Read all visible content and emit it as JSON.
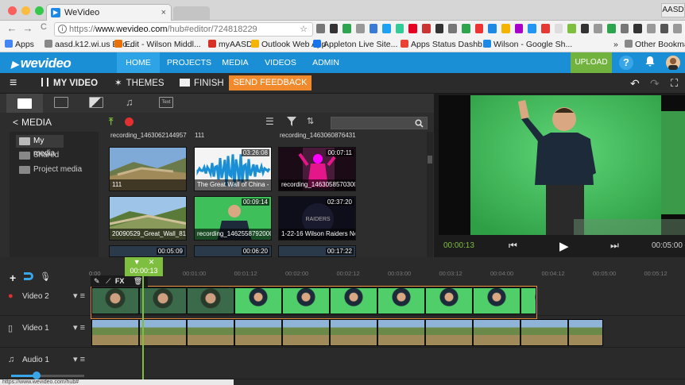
{
  "browser": {
    "tab_title": "WeVideo",
    "tab_close": "×",
    "profile": "AASD",
    "url_prefix": "https://",
    "url_host": "www.wevideo.com",
    "url_path": "/hub#editor/724818229",
    "star": "☆",
    "back": "←",
    "forward": "→",
    "reload": "C",
    "bookmarks": [
      {
        "label": "Apps",
        "color": "#4285f4"
      },
      {
        "label": "aasd.k12.wi.us Boo...",
        "color": "#888888"
      },
      {
        "label": "Edit - Wilson Middl...",
        "color": "#e8710a"
      },
      {
        "label": "myAASD",
        "color": "#d93025"
      },
      {
        "label": "Outlook Web App",
        "color": "#f4b400"
      },
      {
        "label": "Appleton Live Site...",
        "color": "#1a73e8"
      },
      {
        "label": "Apps Status Dashb...",
        "color": "#ea4335"
      },
      {
        "label": "Wilson - Google Sh...",
        "color": "#1e88e5"
      },
      {
        "label": "»",
        "color": ""
      },
      {
        "label": "Other Bookmarks",
        "color": "#888888"
      }
    ]
  },
  "app": {
    "logo": "wevideo",
    "nav": [
      "HOME",
      "PROJECTS",
      "MEDIA",
      "VIDEOS",
      "ADMIN"
    ],
    "upload": "UPLOAD",
    "help": "?",
    "colors": {
      "header": "#1b8fd6",
      "upload": "#72b33f",
      "feedback": "#f08a2c",
      "timeline_accent": "#7fbf3f"
    }
  },
  "toolbar": {
    "menu_icon": "≡",
    "project_title": "MY VIDEO",
    "themes": "THEMES",
    "finish": "FINISH",
    "feedback": "SEND FEEDBACK",
    "undo": "↶",
    "redo": "↷"
  },
  "media": {
    "tabs": [
      "video-tab",
      "transition-tab",
      "graphics-tab",
      "music-tab",
      "text-tab"
    ],
    "text_tab_label": "Text",
    "header": "MEDIA",
    "back_chevron": "<",
    "folders": [
      "My media",
      "Shared",
      "Project media"
    ],
    "top_row": [
      "recording_1463062144957",
      "111",
      "recording_1463060876431"
    ],
    "items": [
      {
        "label": "111",
        "duration": "",
        "kind": "wall"
      },
      {
        "label": "The Great Wall of China - U...",
        "duration": "03:26:08",
        "kind": "audio"
      },
      {
        "label": "recording_1463058570300",
        "duration": "00:07:11",
        "kind": "pink"
      },
      {
        "label": "20090529_Great_Wall_8185",
        "duration": "",
        "kind": "wall2"
      },
      {
        "label": "recording_1462558792000",
        "duration": "00:09:14",
        "kind": "green"
      },
      {
        "label": "1-22-16 Wilson Raiders Ne...",
        "duration": "02:37:20",
        "kind": "raiders"
      },
      {
        "label": "",
        "duration": "00:05:09",
        "kind": "dark"
      },
      {
        "label": "",
        "duration": "00:06:20",
        "kind": "dark"
      },
      {
        "label": "",
        "duration": "00:17:22",
        "kind": "dark"
      }
    ],
    "raiders_text": "RAIDERS"
  },
  "preview": {
    "current_time": "00:00:13",
    "end_time": "00:05:00",
    "prev": "⏮",
    "play": "▶",
    "next": "⏭"
  },
  "timeline": {
    "playhead_time": "00:00:13",
    "ruler_start": "0:00",
    "ticks": [
      "00:01:00",
      "00:01:12",
      "00:02:00",
      "00:02:12",
      "00:03:00",
      "00:03:12",
      "00:04:00",
      "00:04:12",
      "00:05:00",
      "00:05:12"
    ],
    "clip_tools": "FX",
    "tracks": [
      {
        "name": "Video 2",
        "frames": 10,
        "kind": "green"
      },
      {
        "name": "Video 1",
        "frames": 11,
        "kind": "wall"
      },
      {
        "name": "Audio 1",
        "frames": 0,
        "kind": "audio"
      }
    ],
    "volume_fraction": 0.35
  },
  "status_url": "https://www.wevideo.com/hub#"
}
